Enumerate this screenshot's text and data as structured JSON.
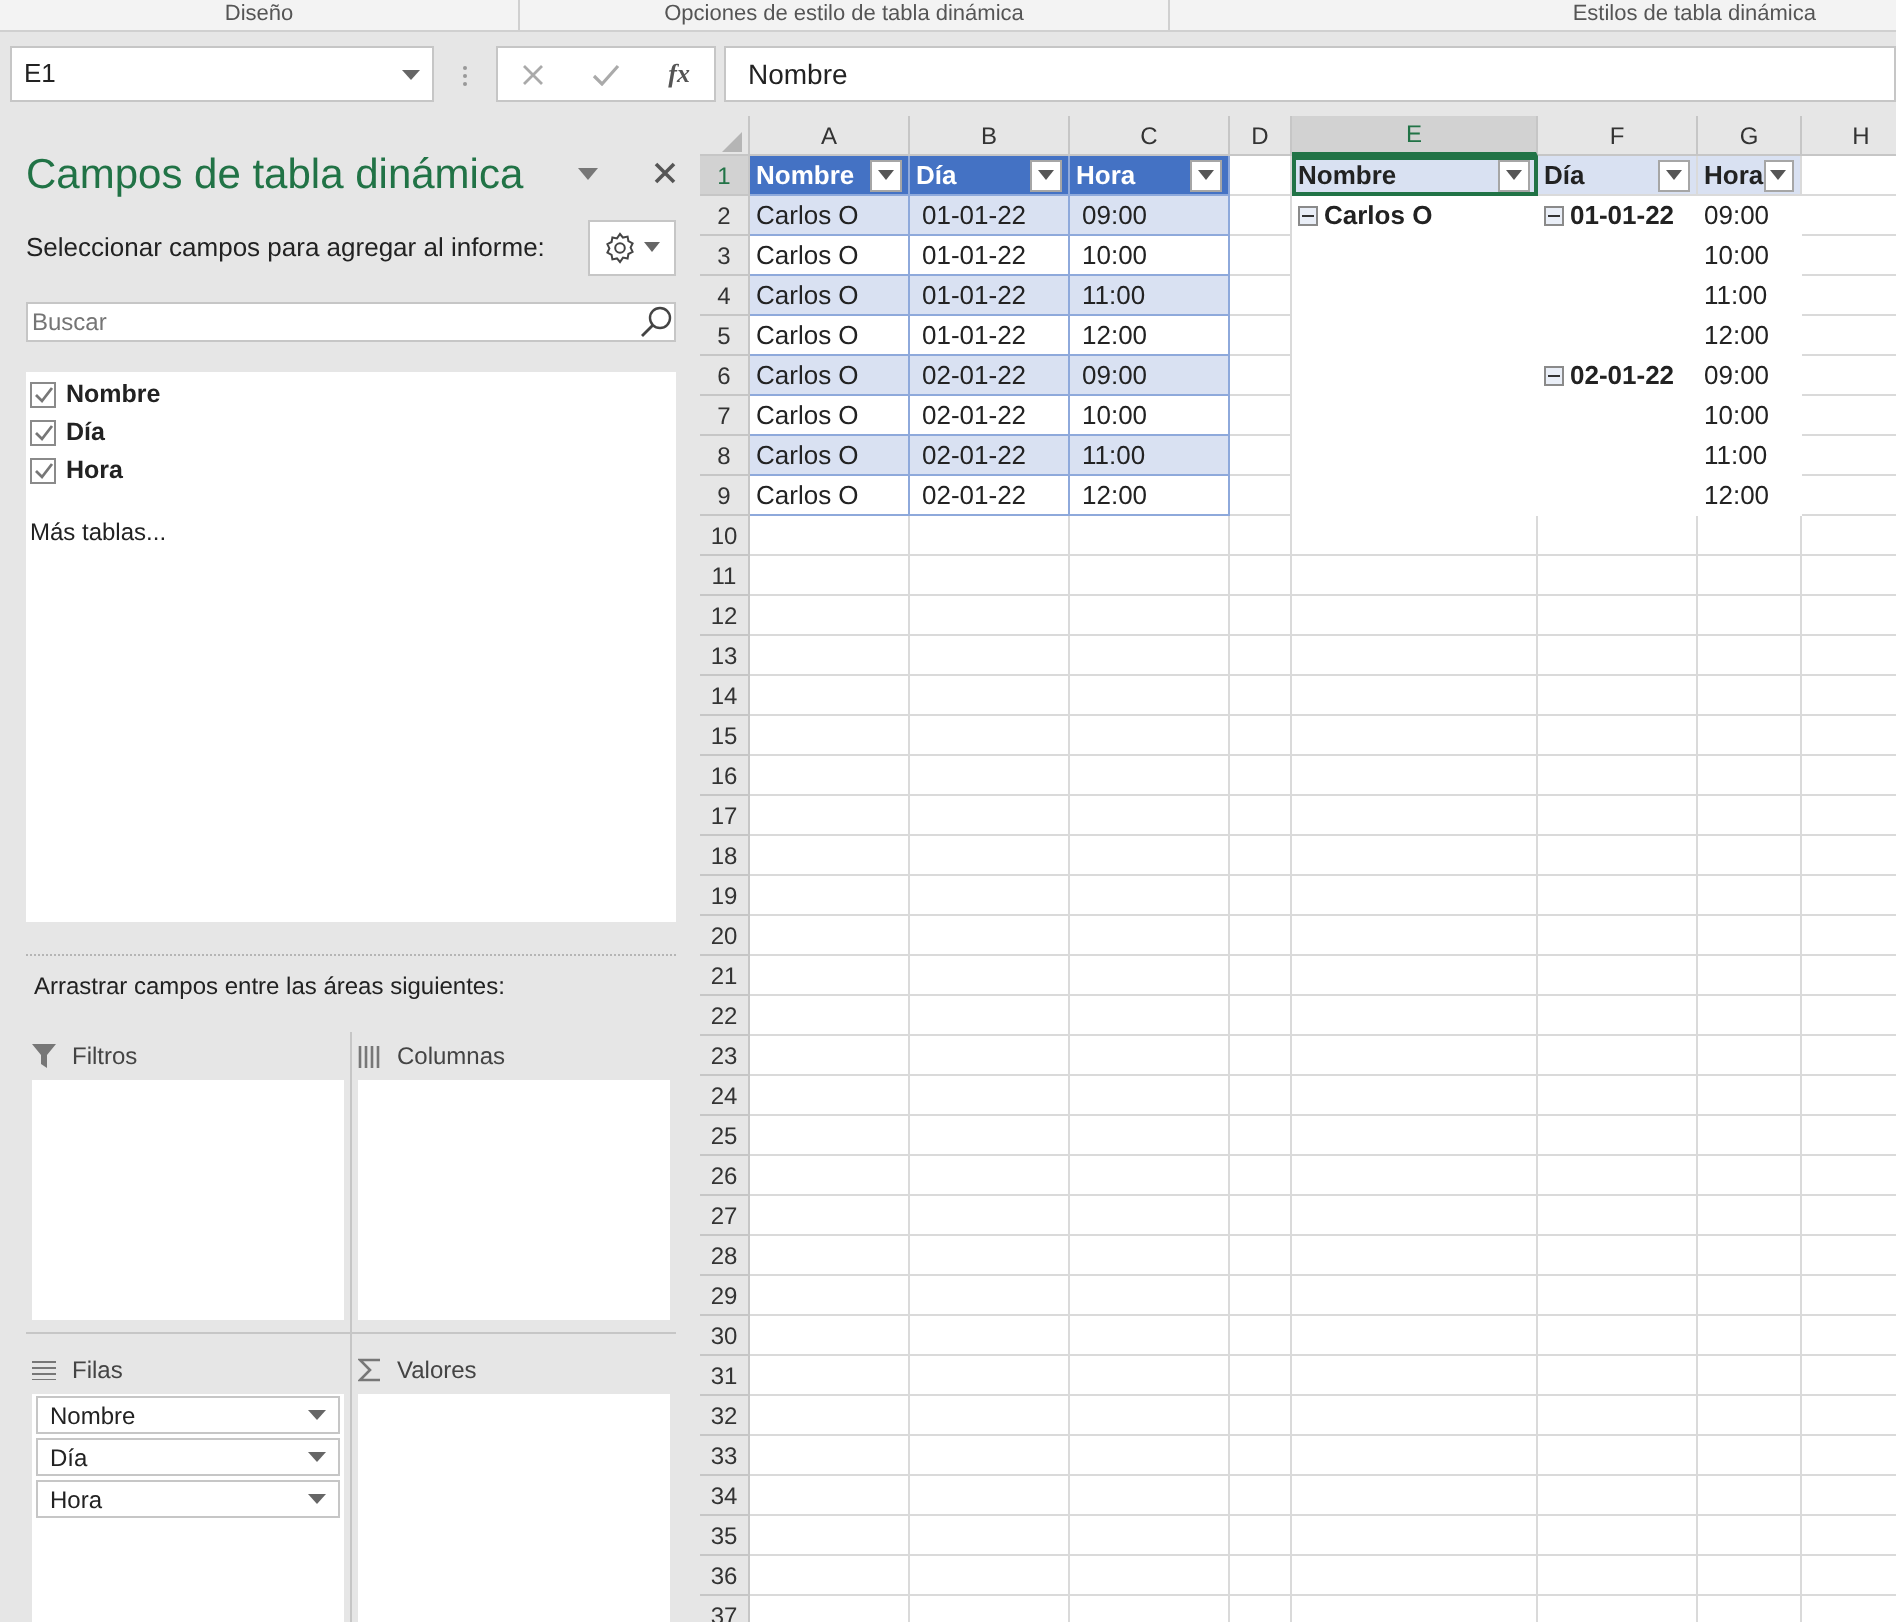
{
  "ribbon_groups": [
    {
      "label": "Diseño"
    },
    {
      "label": "Opciones de estilo de tabla dinámica"
    },
    {
      "label": "Estilos de tabla dinámica"
    }
  ],
  "formula_bar": {
    "name_box": "E1",
    "function_button": "fx",
    "formula": "Nombre"
  },
  "pivot_panel": {
    "title": "Campos de tabla dinámica",
    "subtitle": "Seleccionar campos para agregar al informe:",
    "search": {
      "placeholder": "Buscar"
    },
    "fields": [
      {
        "label": "Nombre",
        "checked": true
      },
      {
        "label": "Día",
        "checked": true
      },
      {
        "label": "Hora",
        "checked": true
      }
    ],
    "more_tables": "Más tablas...",
    "areas_hint": "Arrastrar campos entre las áreas siguientes:",
    "areas": [
      {
        "kind": "filters",
        "label": "Filtros"
      },
      {
        "kind": "columns",
        "label": "Columnas"
      },
      {
        "kind": "rows",
        "label": "Filas",
        "items": [
          "Nombre",
          "Día",
          "Hora"
        ]
      },
      {
        "kind": "values",
        "label": "Valores"
      }
    ]
  },
  "sheet": {
    "columns": [
      {
        "label": "A",
        "selected": false
      },
      {
        "label": "B",
        "selected": false
      },
      {
        "label": "C",
        "selected": false
      },
      {
        "label": "D",
        "selected": false
      },
      {
        "label": "E",
        "selected": true
      },
      {
        "label": "F",
        "selected": false
      },
      {
        "label": "G",
        "selected": false
      },
      {
        "label": "H",
        "selected": false
      }
    ],
    "rows": [
      {
        "label": "1",
        "selected": true
      },
      {
        "label": "2",
        "selected": false
      },
      {
        "label": "3",
        "selected": false
      },
      {
        "label": "4",
        "selected": false
      },
      {
        "label": "5",
        "selected": false
      },
      {
        "label": "6",
        "selected": false
      },
      {
        "label": "7",
        "selected": false
      },
      {
        "label": "8",
        "selected": false
      },
      {
        "label": "9",
        "selected": false
      },
      {
        "label": "10",
        "selected": false
      },
      {
        "label": "11",
        "selected": false
      },
      {
        "label": "12",
        "selected": false
      },
      {
        "label": "13",
        "selected": false
      },
      {
        "label": "14",
        "selected": false
      },
      {
        "label": "15",
        "selected": false
      },
      {
        "label": "16",
        "selected": false
      },
      {
        "label": "17",
        "selected": false
      },
      {
        "label": "18",
        "selected": false
      },
      {
        "label": "19",
        "selected": false
      },
      {
        "label": "20",
        "selected": false
      },
      {
        "label": "21",
        "selected": false
      },
      {
        "label": "22",
        "selected": false
      },
      {
        "label": "23",
        "selected": false
      },
      {
        "label": "24",
        "selected": false
      },
      {
        "label": "25",
        "selected": false
      },
      {
        "label": "26",
        "selected": false
      },
      {
        "label": "27",
        "selected": false
      },
      {
        "label": "28",
        "selected": false
      },
      {
        "label": "29",
        "selected": false
      },
      {
        "label": "30",
        "selected": false
      },
      {
        "label": "31",
        "selected": false
      },
      {
        "label": "32",
        "selected": false
      },
      {
        "label": "33",
        "selected": false
      },
      {
        "label": "34",
        "selected": false
      },
      {
        "label": "35",
        "selected": false
      },
      {
        "label": "36",
        "selected": false
      },
      {
        "label": "37",
        "selected": false
      }
    ],
    "table": {
      "headers": [
        "Nombre",
        "Día",
        "Hora"
      ],
      "rows": [
        [
          "Carlos O",
          "01-01-22",
          "09:00"
        ],
        [
          "Carlos O",
          "01-01-22",
          "10:00"
        ],
        [
          "Carlos O",
          "01-01-22",
          "11:00"
        ],
        [
          "Carlos O",
          "01-01-22",
          "12:00"
        ],
        [
          "Carlos O",
          "02-01-22",
          "09:00"
        ],
        [
          "Carlos O",
          "02-01-22",
          "10:00"
        ],
        [
          "Carlos O",
          "02-01-22",
          "11:00"
        ],
        [
          "Carlos O",
          "02-01-22",
          "12:00"
        ]
      ]
    },
    "pivot_table": {
      "headers": [
        "Nombre",
        "Día",
        "Hora"
      ],
      "rows": [
        {
          "label": "Carlos O",
          "expanded": true,
          "children": [
            {
              "label": "01-01-22",
              "expanded": true,
              "children": [
                {
                  "label": "09:00"
                },
                {
                  "label": "10:00"
                },
                {
                  "label": "11:00"
                },
                {
                  "label": "12:00"
                }
              ]
            },
            {
              "label": "02-01-22",
              "expanded": true,
              "children": [
                {
                  "label": "09:00"
                },
                {
                  "label": "10:00"
                },
                {
                  "label": "11:00"
                },
                {
                  "label": "12:00"
                }
              ]
            }
          ]
        }
      ]
    }
  }
}
